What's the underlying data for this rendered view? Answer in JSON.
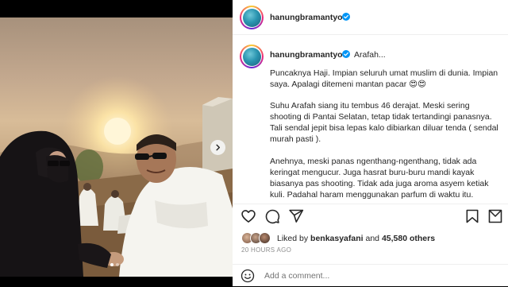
{
  "post": {
    "username": "hanungbramantyo",
    "verified": true,
    "caption_first_line": "Arafah...",
    "caption_paragraphs": [
      "Puncaknya Haji. Impian seluruh umat muslim di dunia. Impian saya. Apalagi ditemeni mantan pacar 😍😍",
      "Suhu Arafah siang itu tembus 46 derajat. Meski sering shooting di Pantai Selatan, tetap tidak tertandingi panasnya. Tali sendal jepit bisa lepas kalo dibiarkan diluar tenda ( sendal murah pasti ).",
      "Anehnya, meski panas ngenthang-ngenthang, tidak ada keringat mengucur. Juga hasrat buru-buru mandi kayak biasanya pas shooting. Tidak ada juga aroma asyem ketiak kuli. Padahal haram menggunakan parfum di waktu itu."
    ],
    "likes": {
      "prefix": "Liked by",
      "liker": "benkasyafani",
      "connector": "and",
      "others": "45,580 others"
    },
    "timestamp": "20 HOURS AGO",
    "comment_placeholder": "Add a comment...",
    "carousel": {
      "total": 2,
      "current": 1
    }
  },
  "icons": {
    "like": "heart-icon",
    "comment": "speech-bubble-icon",
    "share": "paper-plane-icon",
    "save": "bookmark-icon",
    "grid": "grid-icon",
    "emoji": "smiley-icon",
    "next": "chevron-right-icon",
    "verified": "verified-badge-icon"
  },
  "colors": {
    "verified_blue": "#0095f6",
    "text_primary": "#262626",
    "text_secondary": "#8e8e8e",
    "divider": "#efefef"
  }
}
